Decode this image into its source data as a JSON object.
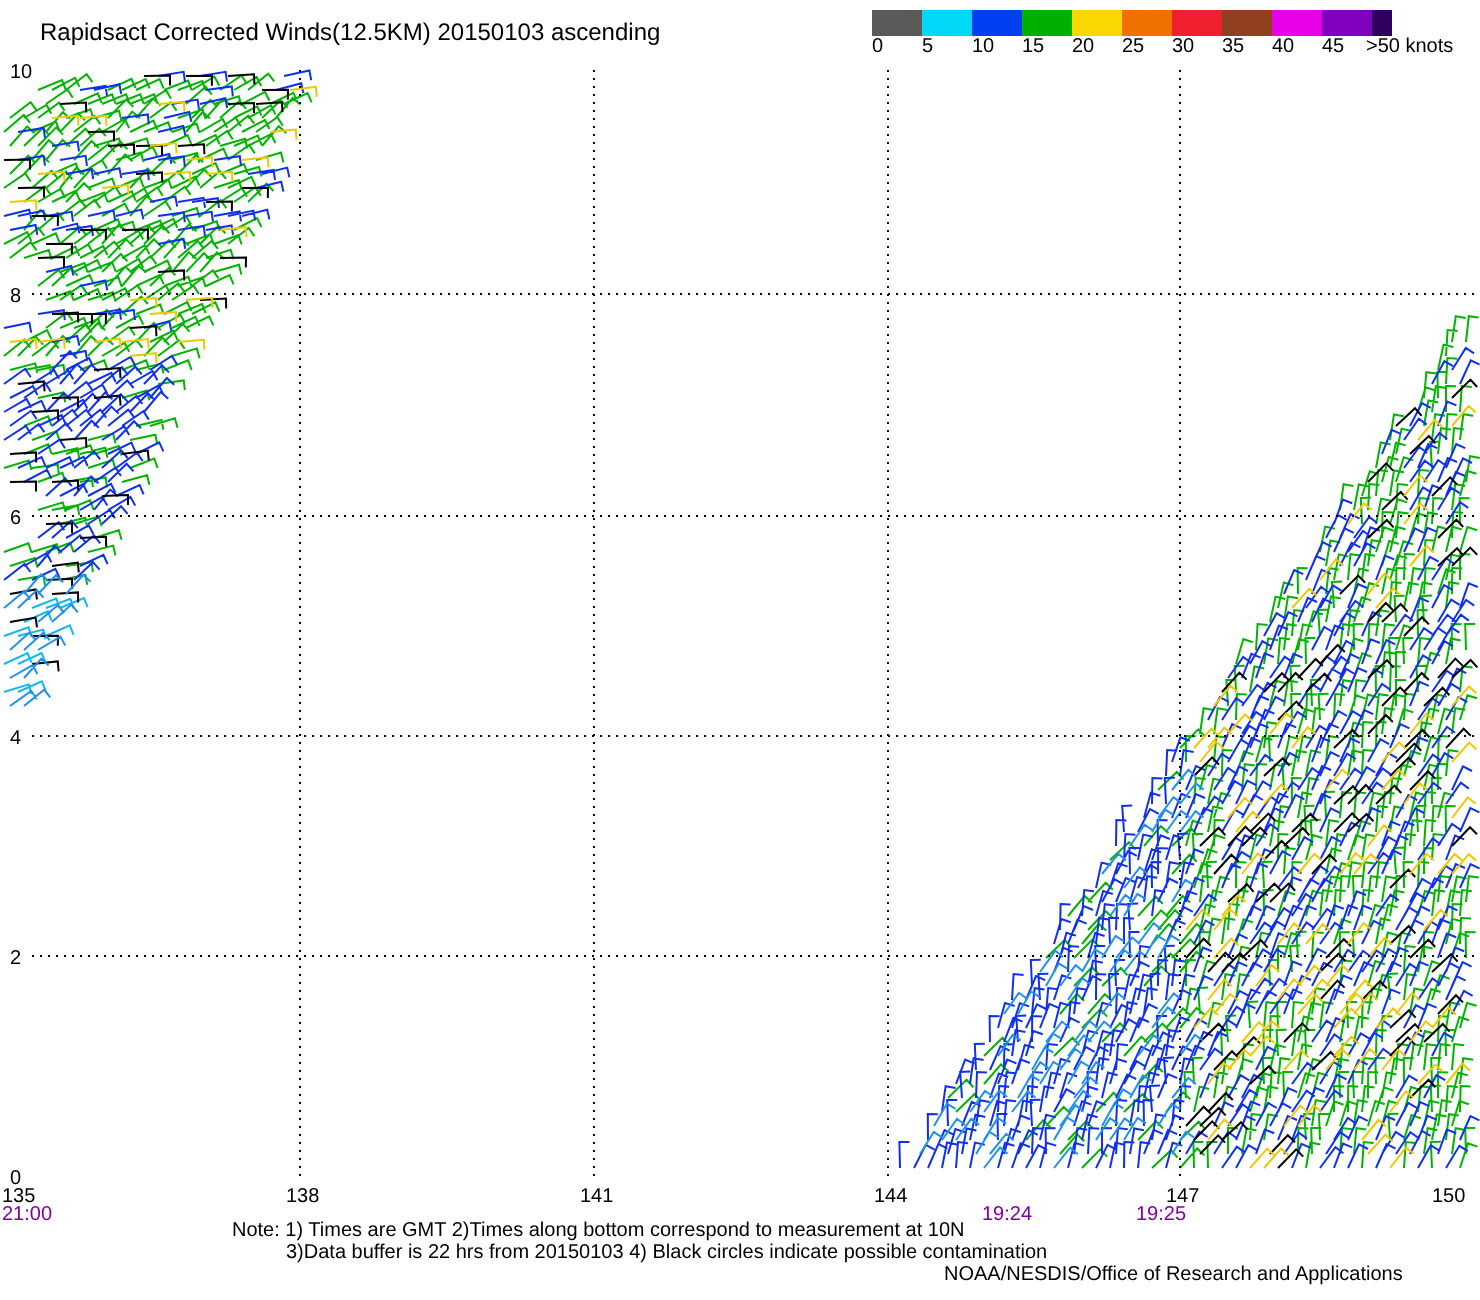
{
  "title": "Rapidsact Corrected Winds(12.5KM) 20150103 ascending",
  "legend": {
    "segments": [
      {
        "color": "#5a5a5a"
      },
      {
        "color": "#00d8f8"
      },
      {
        "color": "#0040f0"
      },
      {
        "color": "#00b000"
      },
      {
        "color": "#f8d800"
      },
      {
        "color": "#f07000"
      },
      {
        "color": "#f02030"
      },
      {
        "color": "#904020"
      },
      {
        "color": "#e800e8"
      },
      {
        "color": "#8000c0"
      },
      {
        "color": "#300060"
      }
    ],
    "labels": [
      "0",
      "5",
      "10",
      "15",
      "20",
      "25",
      "30",
      "35",
      "40",
      "45",
      ">50 knots"
    ]
  },
  "map": {
    "yticks": [
      "10",
      "8",
      "6",
      "4",
      "2",
      "0"
    ],
    "xticks": [
      "135",
      "138",
      "141",
      "144",
      "147",
      "150"
    ],
    "times": [
      "21:00",
      "19:24",
      "19:25"
    ]
  },
  "notes": [
    "Note: 1) Times are GMT 2)Times along bottom correspond to measurement at 10N",
    "3)Data buffer is 22 hrs from 20150103 4) Black circles indicate possible contamination"
  ],
  "credit": "NOAA/NESDIS/Office of Research and Applications"
}
